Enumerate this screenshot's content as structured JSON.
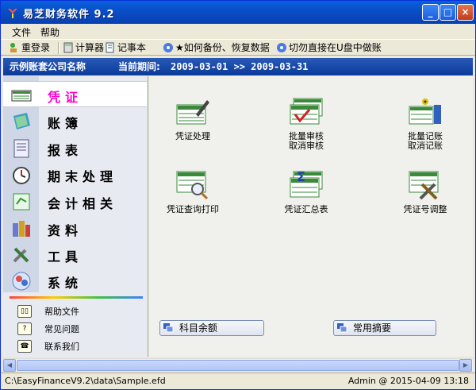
{
  "window": {
    "title": "易芝财务软件 9.2",
    "minimize": "_",
    "maximize": "□",
    "close": "×"
  },
  "menu": [
    {
      "label": "文件"
    },
    {
      "label": "帮助"
    }
  ],
  "toolbar": [
    {
      "label": "重登录",
      "icon": "relogin-icon"
    },
    {
      "label": "计算器",
      "icon": "calculator-icon"
    },
    {
      "label": "记事本",
      "icon": "notepad-icon"
    },
    {
      "label": "★如何备份、恢复数据",
      "icon": "backup-icon"
    },
    {
      "label": "切勿直接在U盘中做账",
      "icon": "usb-warning-icon"
    }
  ],
  "info": {
    "company": "示例账套公司名称",
    "period_label": "当前期间:",
    "period_range": "2009-03-01 >> 2009-03-31"
  },
  "nav": [
    {
      "label": "凭证",
      "icon": "voucher-icon",
      "active": true
    },
    {
      "label": "账簿",
      "icon": "ledger-icon"
    },
    {
      "label": "报表",
      "icon": "report-icon"
    },
    {
      "label": "期末处理",
      "icon": "period-end-icon"
    },
    {
      "label": "会计相关",
      "icon": "accounting-icon"
    },
    {
      "label": "资料",
      "icon": "data-icon"
    },
    {
      "label": "工具",
      "icon": "tools-icon"
    },
    {
      "label": "系统",
      "icon": "system-icon"
    }
  ],
  "help": [
    {
      "label": "帮助文件",
      "icon": "help-book-icon"
    },
    {
      "label": "常见问题",
      "icon": "faq-icon"
    },
    {
      "label": "联系我们",
      "icon": "phone-icon"
    }
  ],
  "functions": [
    {
      "line1": "凭证处理",
      "line2": "",
      "icon": "voucher-process-icon"
    },
    {
      "line1": "批量审核",
      "line2": "取消审核",
      "icon": "batch-audit-icon"
    },
    {
      "line1": "批量记账",
      "line2": "取消记账",
      "icon": "batch-post-icon"
    },
    {
      "line1": "凭证查询打印",
      "line2": "",
      "icon": "voucher-search-icon"
    },
    {
      "line1": "凭证汇总表",
      "line2": "",
      "icon": "voucher-summary-icon"
    },
    {
      "line1": "凭证号调整",
      "line2": "",
      "icon": "voucher-number-icon"
    }
  ],
  "quick_buttons": [
    {
      "label": "科目余额",
      "icon": "account-balance-icon"
    },
    {
      "label": "常用摘要",
      "icon": "common-summary-icon"
    }
  ],
  "status": {
    "path": "C:\\EasyFinanceV9.2\\data\\Sample.efd",
    "user_time": "Admin @ 2015-04-09 13:18"
  },
  "colors": {
    "accent": "#0a4fc8",
    "active_nav": "#ff00cc"
  }
}
